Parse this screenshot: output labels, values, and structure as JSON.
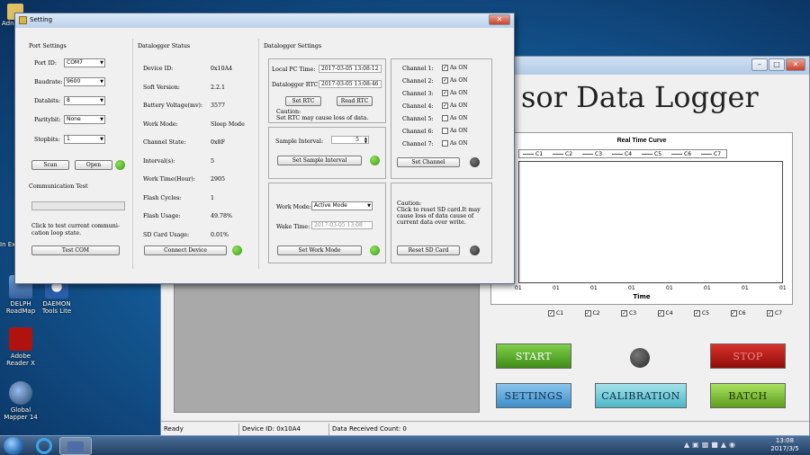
{
  "desktop": {
    "icons": [
      {
        "label": "DELPH RoadMap",
        "name": "delph-roadmap-icon"
      },
      {
        "label": "DAEMON Tools Lite",
        "name": "daemon-tools-icon"
      },
      {
        "label": "Adobe Reader X",
        "name": "adobe-reader-icon"
      },
      {
        "label": "Global Mapper 14",
        "name": "global-mapper-icon"
      }
    ],
    "partial_labels": [
      "Adn",
      "In Ex"
    ]
  },
  "main": {
    "title": "sor Data Logger",
    "chart_title": "Real Time Curve",
    "legend": [
      "C1",
      "C2",
      "C3",
      "C4",
      "C5",
      "C6",
      "C7"
    ],
    "x_ticks": [
      "01",
      "01",
      "01",
      "01",
      "01",
      "01",
      "01",
      "01"
    ],
    "x_label": "Time",
    "checkboxes": [
      "C1",
      "C2",
      "C3",
      "C4",
      "C5",
      "C6",
      "C7"
    ],
    "buttons": {
      "start": "START",
      "stop": "STOP",
      "settings": "SETTINGS",
      "calibration": "CALIBRATION",
      "batch": "BATCH"
    },
    "status": {
      "ready": "Ready",
      "device": "Device ID: 0x10A4",
      "count": "Data Received Count: 0"
    }
  },
  "dialog": {
    "title": "Setting",
    "port": {
      "header": "Port Settings",
      "port_id_label": "Port ID:",
      "port_id": "COM7",
      "baud_label": "Baudrate:",
      "baud": "9600",
      "databits_label": "Databits:",
      "databits": "8",
      "parity_label": "Paritybit:",
      "parity": "None",
      "stop_label": "Stopbits:",
      "stop": "1",
      "scan": "Scan",
      "open": "Open"
    },
    "comm": {
      "header": "Communication Test",
      "hint": "Click to test current communi-cation loop state.",
      "button": "Test COM"
    },
    "status": {
      "header": "Datalogger Status",
      "rows": [
        {
          "k": "Device ID:",
          "v": "0x10A4"
        },
        {
          "k": "Soft Version:",
          "v": "2.2.1"
        },
        {
          "k": "Battery Voltage(mv):",
          "v": "3577"
        },
        {
          "k": "Work Mode:",
          "v": "Sleep Mode"
        },
        {
          "k": "Channel State:",
          "v": "0x8F"
        },
        {
          "k": "Interval(s):",
          "v": "5"
        },
        {
          "k": "Work Time(Hour):",
          "v": "2905"
        },
        {
          "k": "Flash Cycles:",
          "v": "1"
        },
        {
          "k": "Flash Usage:",
          "v": "49.78%"
        },
        {
          "k": "SD Card Usage:",
          "v": "0.01%"
        }
      ],
      "connect": "Connect Device"
    },
    "settings": {
      "header": "Datalogger Settings",
      "pc_label": "Local PC Time:",
      "pc_time": "2017-03-05 13:08:12",
      "rtc_label": "Datalogger RTC:",
      "rtc_time": "2017-03-05 13:08:46",
      "set_rtc": "Set RTC",
      "read_rtc": "Read RTC",
      "caution": "Caution:",
      "rtc_caution": "Set RTC may cause loss of data.",
      "interval_label": "Sample Interval:",
      "interval": "5",
      "set_interval": "Set Sample Interval",
      "work_label": "Work Mode:",
      "work_mode": "Active Mode",
      "wake_label": "Wake Time:",
      "wake_time": "2017-03-05 13:08",
      "set_work": "Set Work Mode",
      "channels": [
        {
          "label": "Channel 1:",
          "on": true
        },
        {
          "label": "Channel 2:",
          "on": true
        },
        {
          "label": "Channel 3:",
          "on": true
        },
        {
          "label": "Channel 4:",
          "on": true
        },
        {
          "label": "Channel 5:",
          "on": false
        },
        {
          "label": "Channel 6:",
          "on": false
        },
        {
          "label": "Channel 7:",
          "on": false
        }
      ],
      "as_on": "As ON",
      "set_channel": "Set Channel",
      "sd_caution": "Click to reset SD card.It may cause loss of data cause of current data over write.",
      "reset_sd": "Reset SD Card"
    }
  },
  "taskbar": {
    "time": "13:08",
    "date": "2017/3/5"
  }
}
